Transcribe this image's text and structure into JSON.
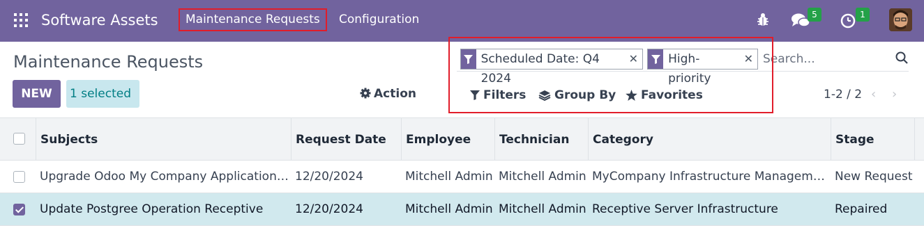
{
  "navbar": {
    "app_name": "Software Assets",
    "menus": [
      "Maintenance Requests",
      "Configuration"
    ],
    "chat_count": "5",
    "activity_count": "1",
    "color": "#71639e"
  },
  "control": {
    "title": "Maintenance Requests",
    "new_label": "NEW",
    "selected_label": "1 selected",
    "action_label": "Action",
    "facets": [
      {
        "label": "Scheduled Date: Q4 2024",
        "icon": "filter-icon"
      },
      {
        "label": "High-priority",
        "icon": "filter-icon"
      }
    ],
    "search_placeholder": "Search...",
    "filters_label": "Filters",
    "groupby_label": "Group By",
    "favorites_label": "Favorites",
    "pager": "1-2 / 2"
  },
  "table": {
    "columns": [
      "Subjects",
      "Request Date",
      "Employee",
      "Technician",
      "Category",
      "Stage"
    ],
    "rows": [
      {
        "checked": false,
        "subject": "Upgrade Odoo My Company Application ...",
        "request_date": "12/20/2024",
        "employee": "Mitchell Admin",
        "technician": "Mitchell Admin",
        "category": "MyCompany Infrastructure Management",
        "stage": "New Request"
      },
      {
        "checked": true,
        "subject": "Update Postgree Operation Receptive",
        "request_date": "12/20/2024",
        "employee": "Mitchell Admin",
        "technician": "Mitchell Admin",
        "category": "Receptive Server Infrastructure",
        "stage": "Repaired"
      }
    ]
  }
}
